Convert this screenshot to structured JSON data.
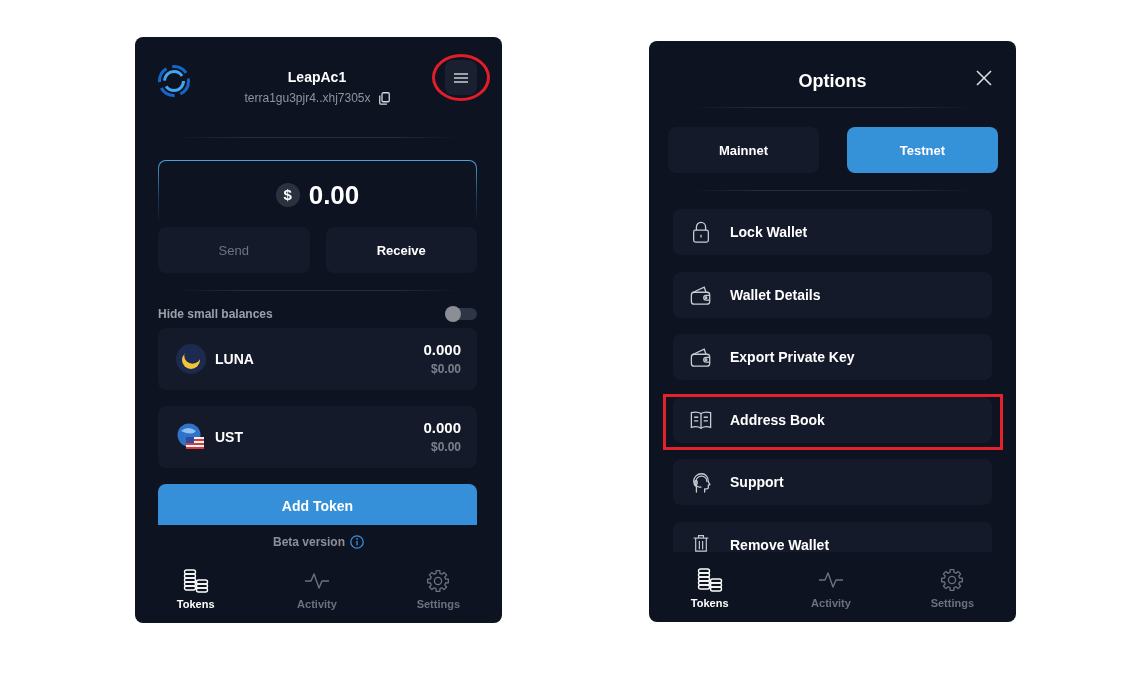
{
  "wallet_screen": {
    "header": {
      "account_name": "LeapAc1",
      "address": "terra1gu3pjr4..xhj7305x",
      "menu_button": {
        "highlighted": true
      }
    },
    "balance": {
      "currency_symbol": "$",
      "amount": "0.00"
    },
    "actions": [
      {
        "label": "Send",
        "disabled": true
      },
      {
        "label": "Receive",
        "disabled": false
      }
    ],
    "hide_small_balances": {
      "label": "Hide small balances",
      "on": false
    },
    "tokens": [
      {
        "symbol": "LUNA",
        "amount": "0.000",
        "value": "$0.00"
      },
      {
        "symbol": "UST",
        "amount": "0.000",
        "value": "$0.00"
      }
    ],
    "add_token_button": "Add Token",
    "version_note": "Beta version",
    "nav": [
      {
        "label": "Tokens",
        "selected": true
      },
      {
        "label": "Activity",
        "selected": false
      },
      {
        "label": "Settings",
        "selected": false
      }
    ]
  },
  "options_screen": {
    "title": "Options",
    "networks": [
      {
        "label": "Mainnet",
        "selected": false
      },
      {
        "label": "Testnet",
        "selected": true
      }
    ],
    "menu_items": [
      {
        "label": "Lock Wallet",
        "highlighted": false
      },
      {
        "label": "Wallet Details",
        "highlighted": false
      },
      {
        "label": "Export Private Key",
        "highlighted": false
      },
      {
        "label": "Address Book",
        "highlighted": true
      },
      {
        "label": "Support",
        "highlighted": false
      },
      {
        "label": "Remove Wallet",
        "highlighted": false
      }
    ],
    "nav": [
      {
        "label": "Tokens",
        "selected": true
      },
      {
        "label": "Activity",
        "selected": false
      },
      {
        "label": "Settings",
        "selected": false
      }
    ]
  }
}
